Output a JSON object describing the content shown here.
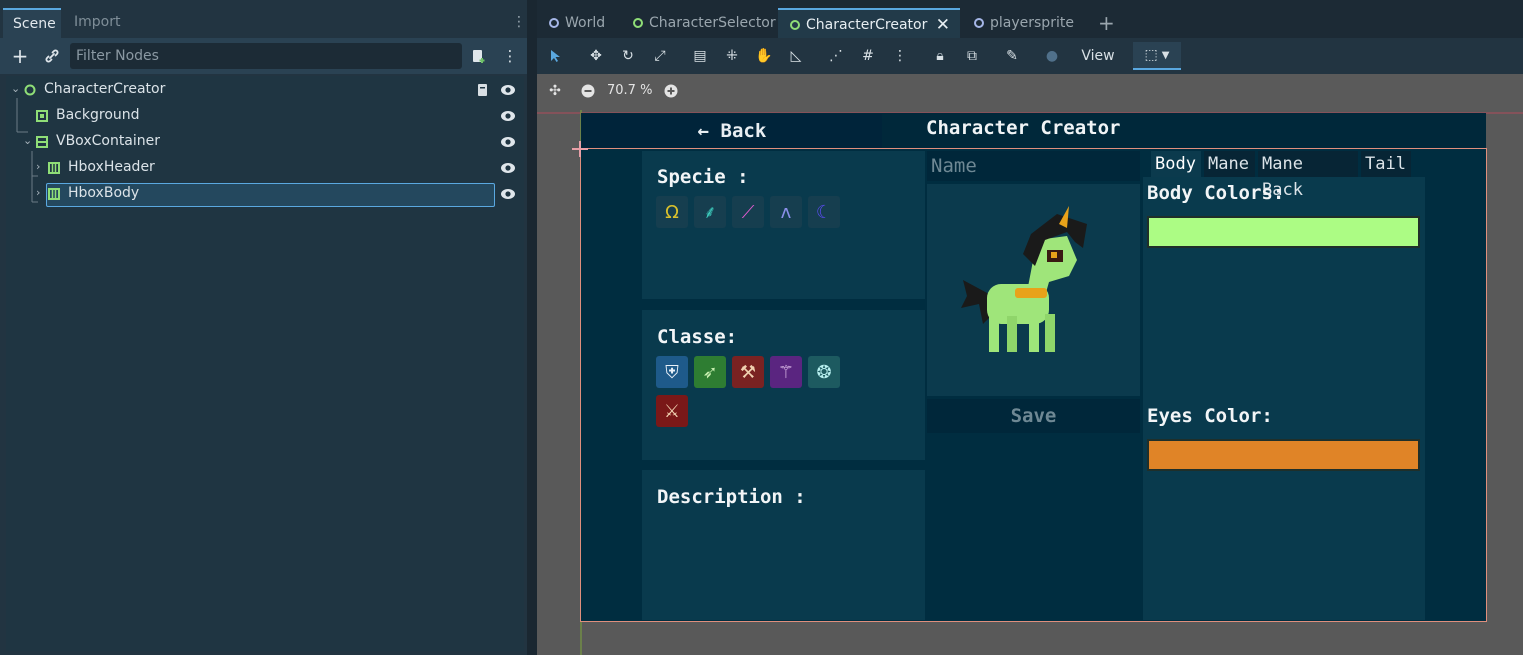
{
  "dock": {
    "tabs": [
      "Scene",
      "Import"
    ],
    "filter_placeholder": "Filter Nodes",
    "tree": [
      {
        "label": "CharacterCreator",
        "icon": "node2d-circle-icon"
      },
      {
        "label": "Background",
        "icon": "colorrect-icon"
      },
      {
        "label": "VBoxContainer",
        "icon": "vbox-icon"
      },
      {
        "label": "HboxHeader",
        "icon": "hbox-icon"
      },
      {
        "label": "HboxBody",
        "icon": "hbox-icon",
        "selected": true
      }
    ]
  },
  "editor": {
    "tabs": [
      "World",
      "CharacterSelector",
      "CharacterCreator",
      "playersprite"
    ],
    "active_tab": "CharacterCreator",
    "view_menu": "View",
    "zoom": "70.7 %"
  },
  "game": {
    "back_label": "← Back",
    "title": "Character Creator",
    "specie_label": "Specie :",
    "classe_label": "Classe:",
    "description_label": "Description :",
    "name_placeholder": "Name",
    "save_label": "Save",
    "color_tabs": [
      "Body",
      "Mane",
      "Mane Back",
      "Tail"
    ],
    "body_colors_label": "Body Colors:",
    "eyes_color_label": "Eyes Color:",
    "body_color": "#acfc84",
    "eyes_color": "#e08427",
    "specie_icons": [
      "horseshoe-icon",
      "feather-icon",
      "horn-icon",
      "claws-icon",
      "moon-icon"
    ],
    "classe_icons": [
      "shield-icon",
      "arrows-icon",
      "axe-icon",
      "staff-icon",
      "orb-icon",
      "crossed-swords-icon"
    ]
  },
  "colors": {
    "accent": "#5aa8e0",
    "canvas_bg": "#002d40",
    "panel_bg": "#093a4d"
  }
}
